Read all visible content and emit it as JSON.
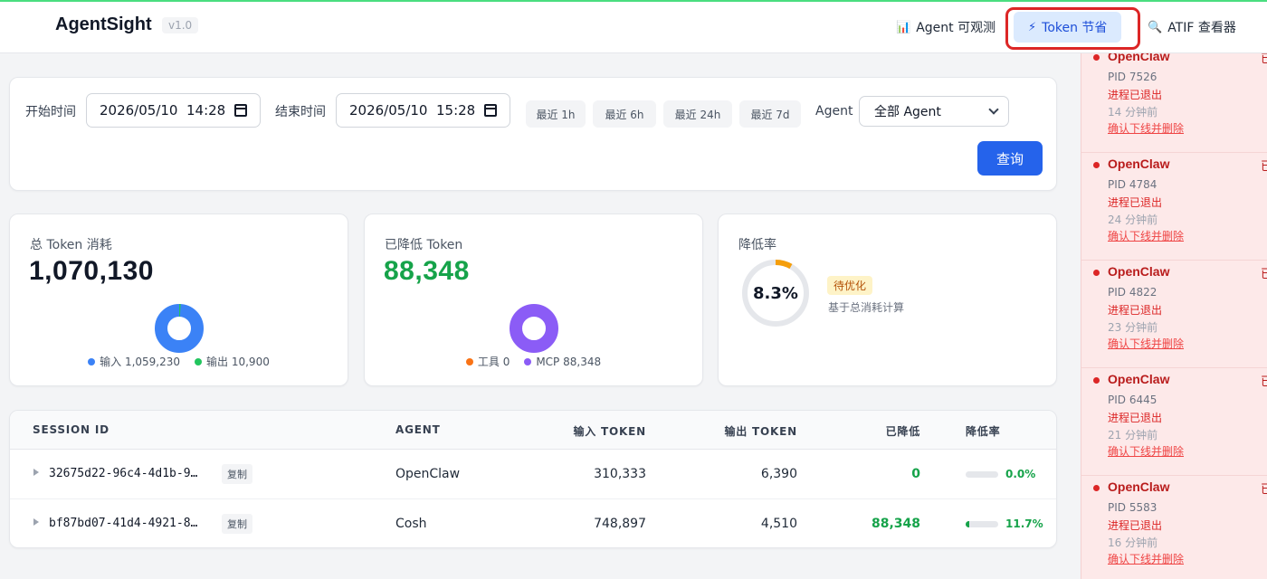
{
  "header": {
    "brand": "AgentSight",
    "version": "v1.0",
    "nav": {
      "observe": {
        "icon": "📊",
        "label": "Agent 可观测"
      },
      "token": {
        "icon": "⚡",
        "label": "Token 节省"
      },
      "atif": {
        "icon": "🔍",
        "label": "ATIF 查看器"
      }
    }
  },
  "filter": {
    "start_label": "开始时间",
    "start_value": "2026/05/10  14:28",
    "end_label": "结束时间",
    "end_value": "2026/05/10  15:28",
    "quick": [
      "最近 1h",
      "最近 6h",
      "最近 24h",
      "最近 7d"
    ],
    "agent_label": "Agent",
    "agent_selected": "全部 Agent",
    "query_label": "查询"
  },
  "stats": {
    "total": {
      "title": "总 Token 消耗",
      "value": "1,070,130",
      "legend": [
        {
          "label": "输入 1,059,230",
          "color": "#3b82f6",
          "value": 1059230
        },
        {
          "label": "输出 10,900",
          "color": "#22c55e",
          "value": 10900
        }
      ]
    },
    "reduced": {
      "title": "已降低 Token",
      "value": "88,348",
      "value_color": "#16a34a",
      "legend": [
        {
          "label": "工具 0",
          "color": "#f97316",
          "value": 0
        },
        {
          "label": "MCP 88,348",
          "color": "#8b5cf6",
          "value": 88348
        }
      ]
    },
    "rate": {
      "title": "降低率",
      "value": "8.3%",
      "fraction": 0.083,
      "badge": "待优化",
      "note": "基于总消耗计算"
    }
  },
  "table": {
    "headers": [
      "SESSION ID",
      "AGENT",
      "输入 TOKEN",
      "输出 TOKEN",
      "已降低",
      "降低率"
    ],
    "copy_label": "复制",
    "rows": [
      {
        "session": "32675d22-96c4-4d1b-9…",
        "agent": "OpenClaw",
        "input": "310,333",
        "output": "6,390",
        "reduced": "0",
        "rate": "0.0%",
        "rate_fraction": 0.0
      },
      {
        "session": "bf87bd07-41d4-4921-8…",
        "agent": "Cosh",
        "input": "748,897",
        "output": "4,510",
        "reduced": "88,348",
        "rate": "11.7%",
        "rate_fraction": 0.117
      }
    ]
  },
  "sidebar": {
    "processes": [
      {
        "name": "OpenClaw",
        "tail": "已",
        "pid": "PID 7526",
        "status": "进程已退出",
        "ago": "14 分钟前",
        "action": "确认下线并删除"
      },
      {
        "name": "OpenClaw",
        "tail": "已",
        "pid": "PID 4784",
        "status": "进程已退出",
        "ago": "24 分钟前",
        "action": "确认下线并删除"
      },
      {
        "name": "OpenClaw",
        "tail": "已",
        "pid": "PID 4822",
        "status": "进程已退出",
        "ago": "23 分钟前",
        "action": "确认下线并删除"
      },
      {
        "name": "OpenClaw",
        "tail": "已",
        "pid": "PID 6445",
        "status": "进程已退出",
        "ago": "21 分钟前",
        "action": "确认下线并删除"
      },
      {
        "name": "OpenClaw",
        "tail": "已",
        "pid": "PID 5583",
        "status": "进程已退出",
        "ago": "16 分钟前",
        "action": "确认下线并删除"
      }
    ]
  }
}
